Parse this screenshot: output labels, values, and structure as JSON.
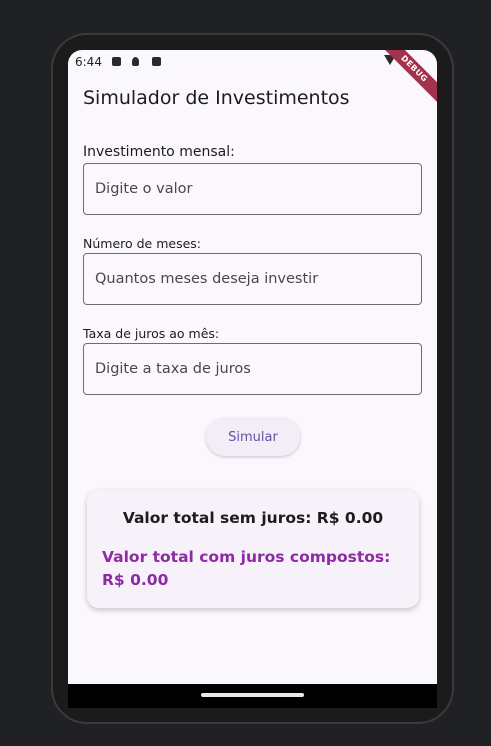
{
  "status_bar": {
    "time": "6:44"
  },
  "debug_banner": {
    "label": "DEBUG"
  },
  "app": {
    "title": "Simulador de Investimentos"
  },
  "form": {
    "monthly_investment": {
      "label": "Investimento mensal:",
      "placeholder": "Digite o valor",
      "value": ""
    },
    "months": {
      "label": "Número de meses:",
      "placeholder": "Quantos meses deseja investir",
      "value": ""
    },
    "interest_rate": {
      "label": "Taxa de juros ao mês:",
      "placeholder": "Digite a taxa de juros",
      "value": ""
    },
    "simulate_label": "Simular"
  },
  "results": {
    "total_without_interest": "Valor total sem juros: R$ 0.00",
    "total_with_compound_interest": "Valor total com juros compostos: R$ 0.00"
  },
  "colors": {
    "accent": "#6750a4",
    "compound_total": "#8e2aa3",
    "debug_ribbon": "#a3324d",
    "background": "#fbf8fd"
  },
  "icons": [
    "play-protect-icon",
    "notification-icon",
    "android-icon",
    "wifi-icon"
  ]
}
